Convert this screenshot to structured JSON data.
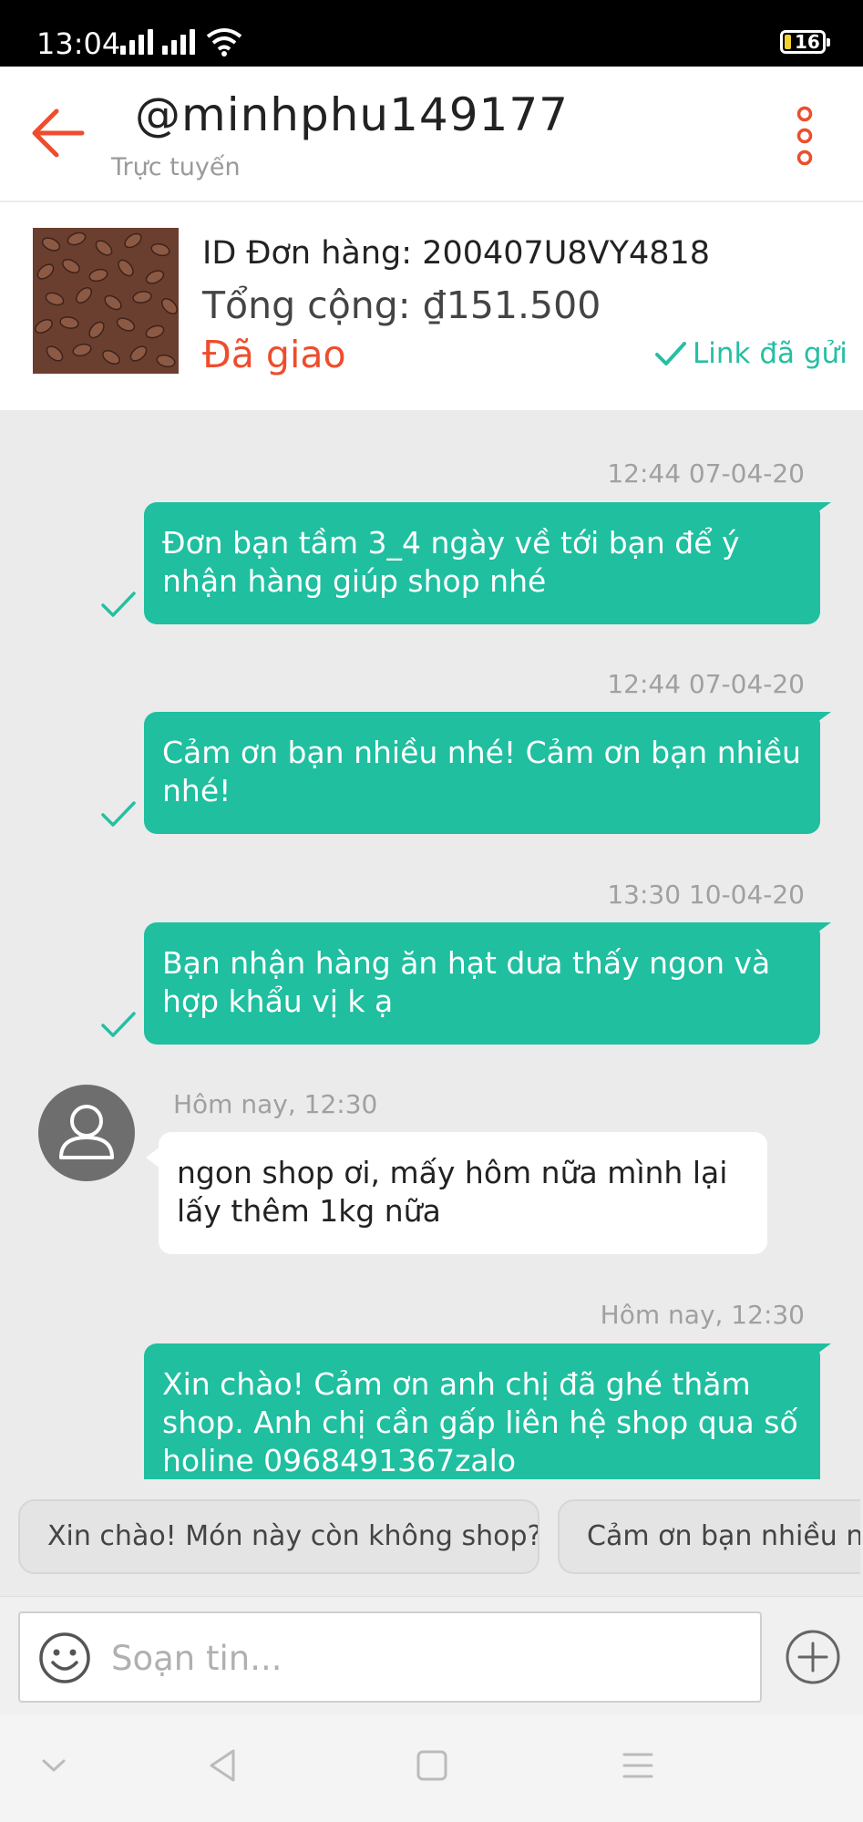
{
  "status_bar": {
    "time": "13:04",
    "battery_level": "16",
    "icons": [
      "signal-icon",
      "signal-icon",
      "wifi-icon",
      "battery-icon"
    ]
  },
  "header": {
    "username": "@minhphu149177",
    "presence": "Trực tuyến",
    "icons": [
      "back-arrow-icon",
      "more-vertical-icon"
    ],
    "accent_color": "#ee4d2d"
  },
  "order": {
    "id_text": "ID Đơn hàng: 200407U8VY4818",
    "total_text": "Tổng cộng: ₫151.500",
    "status": "Đã giao",
    "link_sent": "Link đã gửi",
    "image": "watermelon-seeds-photo"
  },
  "messages": [
    {
      "direction": "out",
      "time": "12:44 07-04-20",
      "text": "Đơn bạn tầm 3_4 ngày về tới bạn để ý nhận hàng giúp shop nhé"
    },
    {
      "direction": "out",
      "time": "12:44 07-04-20",
      "text": "Cảm ơn bạn nhiều nhé! Cảm ơn bạn nhiều nhé!"
    },
    {
      "direction": "out",
      "time": "13:30 10-04-20",
      "text": "Bạn nhận hàng ăn hạt dưa thấy ngon và hợp khẩu vị k ạ"
    },
    {
      "direction": "in",
      "time": "Hôm nay, 12:30",
      "text": "ngon shop ơi, mấy hôm nữa mình lại lấy thêm 1kg nữa"
    },
    {
      "direction": "out",
      "time": "Hôm nay, 12:30",
      "text": "Xin chào! Cảm ơn anh chị đã ghé thăm shop. Anh chị cần gấp liên hệ shop qua số holine 0968491367zalo"
    }
  ],
  "quick_replies": [
    "Xin chào! Món này còn không shop?",
    "Cảm ơn bạn nhiều nh"
  ],
  "composer": {
    "placeholder": "Soạn tin...",
    "icons": [
      "emoji-icon",
      "add-icon"
    ]
  },
  "navbar": {
    "icons": [
      "chevron-down-icon",
      "back-triangle-icon",
      "home-square-icon",
      "menu-lines-icon"
    ]
  },
  "colors": {
    "outgoing_bubble": "#1fbfa0",
    "check": "#26bfa2",
    "chat_background": "#ebebeb"
  }
}
